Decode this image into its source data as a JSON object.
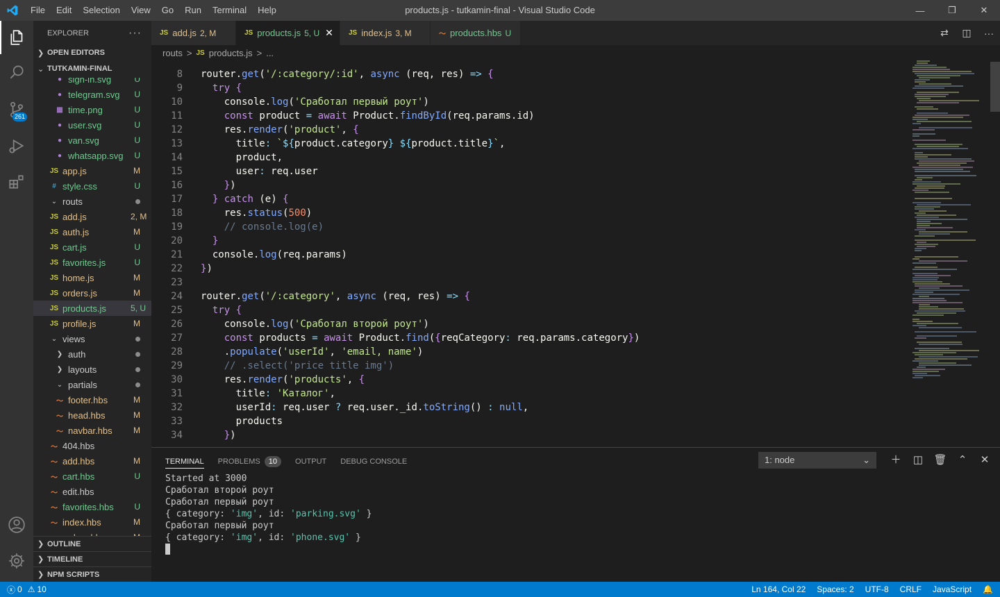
{
  "window": {
    "title": "products.js - tutkamin-final - Visual Studio Code",
    "menu": [
      "File",
      "Edit",
      "Selection",
      "View",
      "Go",
      "Run",
      "Terminal",
      "Help"
    ]
  },
  "activity_bar": {
    "source_control_badge": "261"
  },
  "sidebar": {
    "header": "EXPLORER",
    "open_editors": "OPEN EDITORS",
    "project": "TUTKAMIN-FINAL",
    "tree": [
      {
        "name": "sign-in.svg",
        "icon": "svg",
        "status": "U",
        "indent": 2
      },
      {
        "name": "telegram.svg",
        "icon": "svg",
        "status": "U",
        "indent": 2
      },
      {
        "name": "time.png",
        "icon": "png",
        "status": "U",
        "indent": 2
      },
      {
        "name": "user.svg",
        "icon": "svg",
        "status": "U",
        "indent": 2
      },
      {
        "name": "van.svg",
        "icon": "svg",
        "status": "U",
        "indent": 2
      },
      {
        "name": "whatsapp.svg",
        "icon": "svg",
        "status": "U",
        "indent": 2
      },
      {
        "name": "app.js",
        "icon": "js",
        "status": "M",
        "indent": 1
      },
      {
        "name": "style.css",
        "icon": "css",
        "status": "U",
        "indent": 1
      },
      {
        "name": "routs",
        "icon": "folder-open",
        "status": "dot",
        "indent": 1
      },
      {
        "name": "add.js",
        "icon": "js",
        "status": "2, M",
        "indent": 1
      },
      {
        "name": "auth.js",
        "icon": "js",
        "status": "M",
        "indent": 1
      },
      {
        "name": "cart.js",
        "icon": "js",
        "status": "U",
        "indent": 1
      },
      {
        "name": "favorites.js",
        "icon": "js",
        "status": "U",
        "indent": 1
      },
      {
        "name": "home.js",
        "icon": "js",
        "status": "M",
        "indent": 1
      },
      {
        "name": "orders.js",
        "icon": "js",
        "status": "M",
        "indent": 1
      },
      {
        "name": "products.js",
        "icon": "js",
        "status": "5, U",
        "indent": 1,
        "selected": true
      },
      {
        "name": "profile.js",
        "icon": "js",
        "status": "M",
        "indent": 1
      },
      {
        "name": "views",
        "icon": "folder-open",
        "status": "dot",
        "indent": 1
      },
      {
        "name": "auth",
        "icon": "folder",
        "status": "dot",
        "indent": 2
      },
      {
        "name": "layouts",
        "icon": "folder",
        "status": "dot",
        "indent": 2
      },
      {
        "name": "partials",
        "icon": "folder-open",
        "status": "dot",
        "indent": 2
      },
      {
        "name": "footer.hbs",
        "icon": "hbs",
        "status": "M",
        "indent": 2
      },
      {
        "name": "head.hbs",
        "icon": "hbs",
        "status": "M",
        "indent": 2
      },
      {
        "name": "navbar.hbs",
        "icon": "hbs",
        "status": "M",
        "indent": 2
      },
      {
        "name": "404.hbs",
        "icon": "hbs",
        "status": "",
        "indent": 1
      },
      {
        "name": "add.hbs",
        "icon": "hbs",
        "status": "M",
        "indent": 1
      },
      {
        "name": "cart.hbs",
        "icon": "hbs",
        "status": "U",
        "indent": 1
      },
      {
        "name": "edit.hbs",
        "icon": "hbs",
        "status": "",
        "indent": 1
      },
      {
        "name": "favorites.hbs",
        "icon": "hbs",
        "status": "U",
        "indent": 1
      },
      {
        "name": "index.hbs",
        "icon": "hbs",
        "status": "M",
        "indent": 1
      },
      {
        "name": "orders.hbs",
        "icon": "hbs",
        "status": "M",
        "indent": 1
      }
    ],
    "outline": "OUTLINE",
    "timeline": "TIMELINE",
    "npm_scripts": "NPM SCRIPTS"
  },
  "tabs": [
    {
      "label": "add.js",
      "badge": "2, M",
      "icon": "js",
      "active": false
    },
    {
      "label": "products.js",
      "badge": "5, U",
      "icon": "js",
      "active": true
    },
    {
      "label": "index.js",
      "badge": "3, M",
      "icon": "js",
      "active": false
    },
    {
      "label": "products.hbs",
      "badge": "U",
      "icon": "hbs",
      "active": false
    }
  ],
  "breadcrumb": [
    "routs",
    ">",
    "products.js",
    ">",
    "..."
  ],
  "editor": {
    "lines": [
      {
        "n": "8",
        "code": "router.get('/:category/:id', async (req, res) => {"
      },
      {
        "n": "9",
        "code": "  try {"
      },
      {
        "n": "10",
        "code": "    console.log('Сработал первый роут')"
      },
      {
        "n": "11",
        "code": "    const product = await Product.findById(req.params.id)"
      },
      {
        "n": "12",
        "code": "    res.render('product', {"
      },
      {
        "n": "13",
        "code": "      title: `${product.category} ${product.title}`,"
      },
      {
        "n": "14",
        "code": "      product,"
      },
      {
        "n": "15",
        "code": "      user: req.user"
      },
      {
        "n": "16",
        "code": "    })"
      },
      {
        "n": "17",
        "code": "  } catch (e) {"
      },
      {
        "n": "18",
        "code": "    res.status(500)"
      },
      {
        "n": "19",
        "code": "    // console.log(e)"
      },
      {
        "n": "20",
        "code": "  }"
      },
      {
        "n": "21",
        "code": "  console.log(req.params)"
      },
      {
        "n": "22",
        "code": "})"
      },
      {
        "n": "23",
        "code": ""
      },
      {
        "n": "24",
        "code": "router.get('/:category', async (req, res) => {"
      },
      {
        "n": "25",
        "code": "  try {"
      },
      {
        "n": "26",
        "code": "    console.log('Сработал второй роут')"
      },
      {
        "n": "27",
        "code": "    const products = await Product.find({reqCategory: req.params.category})"
      },
      {
        "n": "28",
        "code": "    .populate('userId', 'email, name')"
      },
      {
        "n": "29",
        "code": "    // .select('price title img')"
      },
      {
        "n": "30",
        "code": "    res.render('products', {"
      },
      {
        "n": "31",
        "code": "      title: 'Каталог',"
      },
      {
        "n": "32",
        "code": "      userId: req.user ? req.user._id.toString() : null,"
      },
      {
        "n": "33",
        "code": "      products"
      },
      {
        "n": "34",
        "code": "    })"
      }
    ]
  },
  "panel": {
    "tabs": [
      "TERMINAL",
      "PROBLEMS",
      "OUTPUT",
      "DEBUG CONSOLE"
    ],
    "problems_count": "10",
    "terminal_select": "1: node",
    "terminal_lines": [
      "Started at 3000",
      "Сработал второй роут",
      "Сработал первый роут",
      "{ category: 'img', id: 'parking.svg' }",
      "Сработал первый роут",
      "{ category: 'img', id: 'phone.svg' }"
    ]
  },
  "statusbar": {
    "errors": "0",
    "warnings": "10",
    "position": "Ln 164, Col 22",
    "spaces": "Spaces: 2",
    "encoding": "UTF-8",
    "eol": "CRLF",
    "language": "JavaScript"
  },
  "colors": {
    "accent": "#007acc",
    "modified": "#e2c08d",
    "untracked": "#73c991"
  }
}
